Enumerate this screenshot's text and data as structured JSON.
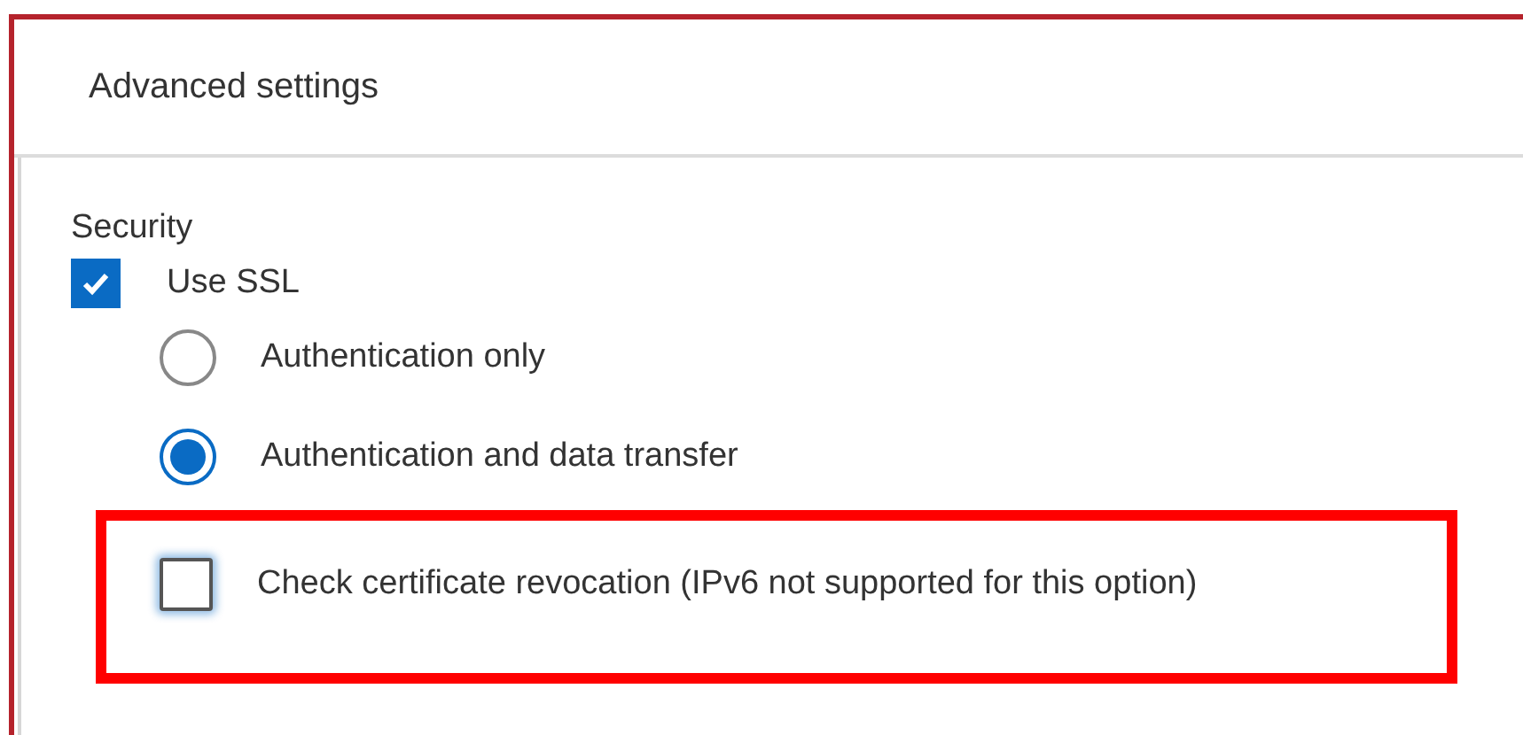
{
  "dialog": {
    "title": "Advanced settings"
  },
  "section": {
    "title": "Security"
  },
  "use_ssl": {
    "label": "Use SSL",
    "checked": true
  },
  "modes": [
    {
      "label": "Authentication only",
      "selected": false
    },
    {
      "label": "Authentication and data transfer",
      "selected": true
    }
  ],
  "revocation": {
    "label": "Check certificate revocation (IPv6 not supported for this option)",
    "checked": false,
    "highlighted": true
  }
}
